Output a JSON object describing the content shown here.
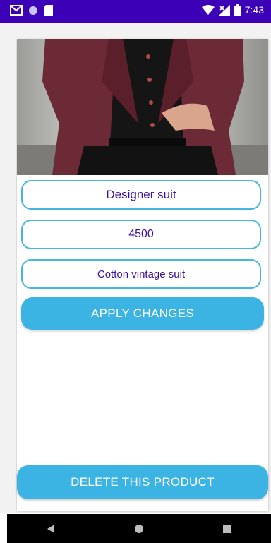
{
  "status_bar": {
    "time": "7:43",
    "icons": [
      "gmail-icon",
      "circle-icon",
      "sd-card-icon",
      "wifi-icon",
      "signal-icon",
      "battery-icon"
    ]
  },
  "product": {
    "name": "Designer suit",
    "price": "4500",
    "description": "Cotton vintage suit"
  },
  "buttons": {
    "apply": "APPLY CHANGES",
    "delete": "DELETE THIS PRODUCT"
  },
  "colors": {
    "status_bar": "#3c00b6",
    "accent": "#3bb3e3",
    "field_border": "#45b6df",
    "field_text": "#3b0fa1"
  },
  "nav": [
    "back-icon",
    "home-icon",
    "recents-icon"
  ]
}
